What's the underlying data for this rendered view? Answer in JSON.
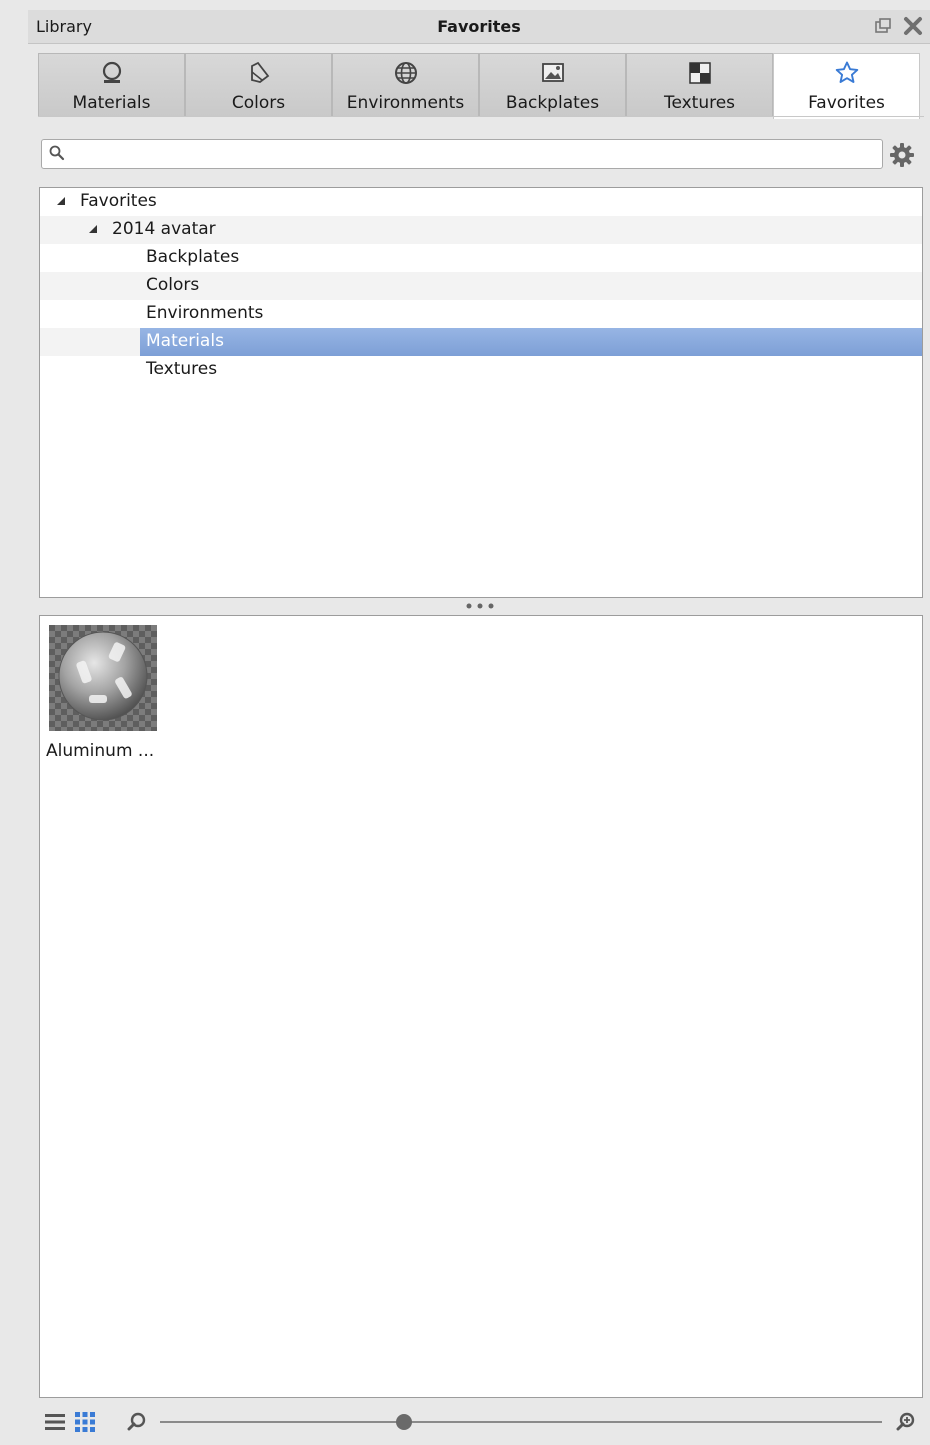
{
  "titlebar": {
    "left": "Library",
    "center": "Favorites"
  },
  "tabs": [
    {
      "label": "Materials",
      "icon": "material-sphere-icon"
    },
    {
      "label": "Colors",
      "icon": "color-swatch-icon"
    },
    {
      "label": "Environments",
      "icon": "globe-icon"
    },
    {
      "label": "Backplates",
      "icon": "image-icon"
    },
    {
      "label": "Textures",
      "icon": "checker-icon"
    },
    {
      "label": "Favorites",
      "icon": "star-icon",
      "active": true
    }
  ],
  "search": {
    "value": "",
    "placeholder": ""
  },
  "tree": {
    "rows": [
      {
        "label": "Favorites"
      },
      {
        "label": "2014 avatar"
      },
      {
        "label": "Backplates"
      },
      {
        "label": "Colors"
      },
      {
        "label": "Environments"
      },
      {
        "label": "Materials",
        "selected": true
      },
      {
        "label": "Textures"
      }
    ]
  },
  "items": [
    {
      "label": "Aluminum ..."
    }
  ],
  "colors": {
    "selection": "#86a6dc",
    "active_tab_icon": "#3a7bd5"
  }
}
